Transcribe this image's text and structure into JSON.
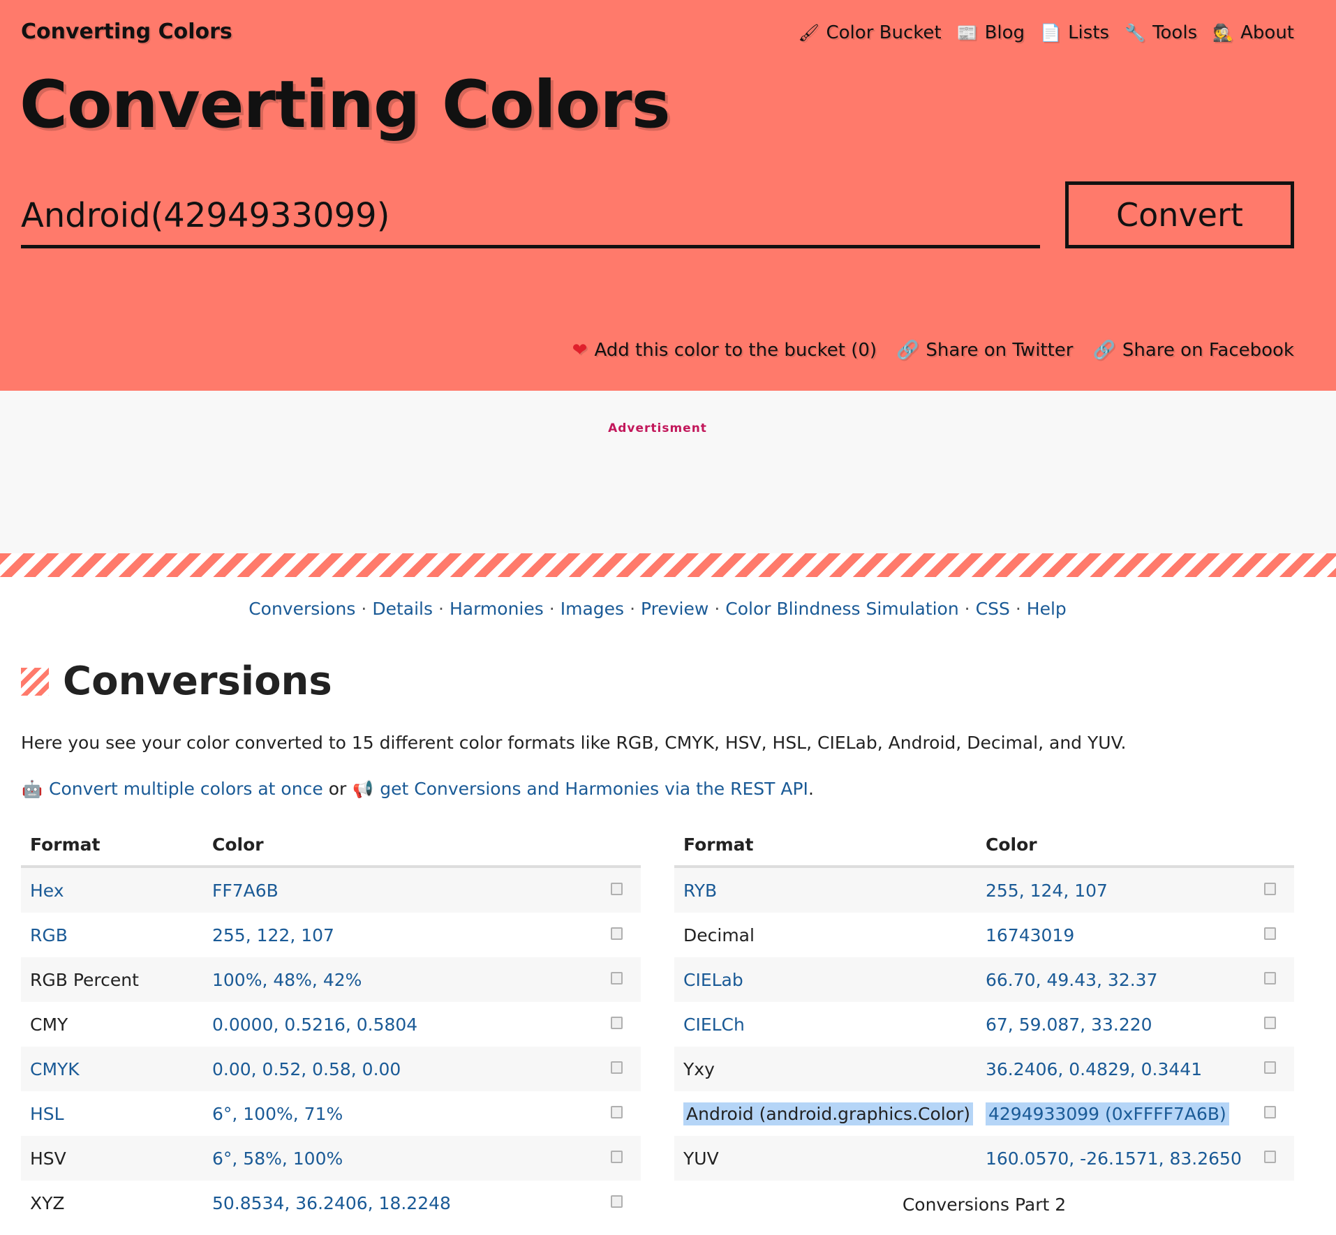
{
  "site": {
    "title": "Converting Colors"
  },
  "nav": [
    {
      "icon": "paintbrush-icon",
      "glyph": "🖌",
      "label": "Color Bucket"
    },
    {
      "icon": "newspaper-icon",
      "glyph": "📰",
      "label": "Blog"
    },
    {
      "icon": "page-icon",
      "glyph": "📄",
      "label": "Lists"
    },
    {
      "icon": "wrench-icon",
      "glyph": "🔧",
      "label": "Tools"
    },
    {
      "icon": "detective-icon",
      "glyph": "🕵",
      "label": "About"
    }
  ],
  "hero": {
    "title": "Converting Colors",
    "input_value": "Android(4294933099)",
    "convert_label": "Convert",
    "bg_color": "#ff7a6b"
  },
  "actions": {
    "bucket": "Add this color to the bucket (0)",
    "twitter": "Share on Twitter",
    "facebook": "Share on Facebook"
  },
  "ad": {
    "label": "Advertisment"
  },
  "section_nav": [
    "Conversions",
    "Details",
    "Harmonies",
    "Images",
    "Preview",
    "Color Blindness Simulation",
    "CSS",
    "Help"
  ],
  "conversions": {
    "title": "Conversions",
    "intro": "Here you see your color converted to 15 different color formats like RGB, CMYK, HSV, HSL, CIELab, Android, Decimal, and YUV.",
    "link_multi": "Convert multiple colors at once",
    "or": "or",
    "link_api": "get Conversions and Harmonies via the REST API",
    "period": ".",
    "col_format": "Format",
    "col_color": "Color",
    "left_rows": [
      {
        "format": "Hex",
        "value": "FF7A6B",
        "link": true
      },
      {
        "format": "RGB",
        "value": "255, 122, 107",
        "link": true
      },
      {
        "format": "RGB Percent",
        "value": "100%, 48%, 42%",
        "link": false
      },
      {
        "format": "CMY",
        "value": "0.0000, 0.5216, 0.5804",
        "link": false
      },
      {
        "format": "CMYK",
        "value": "0.00, 0.52, 0.58, 0.00",
        "link": true
      },
      {
        "format": "HSL",
        "value": "6°, 100%, 71%",
        "link": true
      },
      {
        "format": "HSV",
        "value": "6°, 58%, 100%",
        "link": false
      },
      {
        "format": "XYZ",
        "value": "50.8534, 36.2406, 18.2248",
        "link": false
      }
    ],
    "right_rows": [
      {
        "format": "RYB",
        "value": "255, 124, 107",
        "link": true
      },
      {
        "format": "Decimal",
        "value": "16743019",
        "link": false
      },
      {
        "format": "CIELab",
        "value": "66.70, 49.43, 32.37",
        "link": true
      },
      {
        "format": "CIELCh",
        "value": "67, 59.087, 33.220",
        "link": true
      },
      {
        "format": "Yxy",
        "value": "36.2406, 0.4829, 0.3441",
        "link": false
      },
      {
        "format": "Android (android.graphics.Color)",
        "value": "4294933099 (0xFFFF7A6B)",
        "link": false,
        "highlight": true
      },
      {
        "format": "YUV",
        "value": "160.0570, -26.1571, 83.2650",
        "link": false
      }
    ],
    "right_caption": "Conversions Part 2"
  }
}
